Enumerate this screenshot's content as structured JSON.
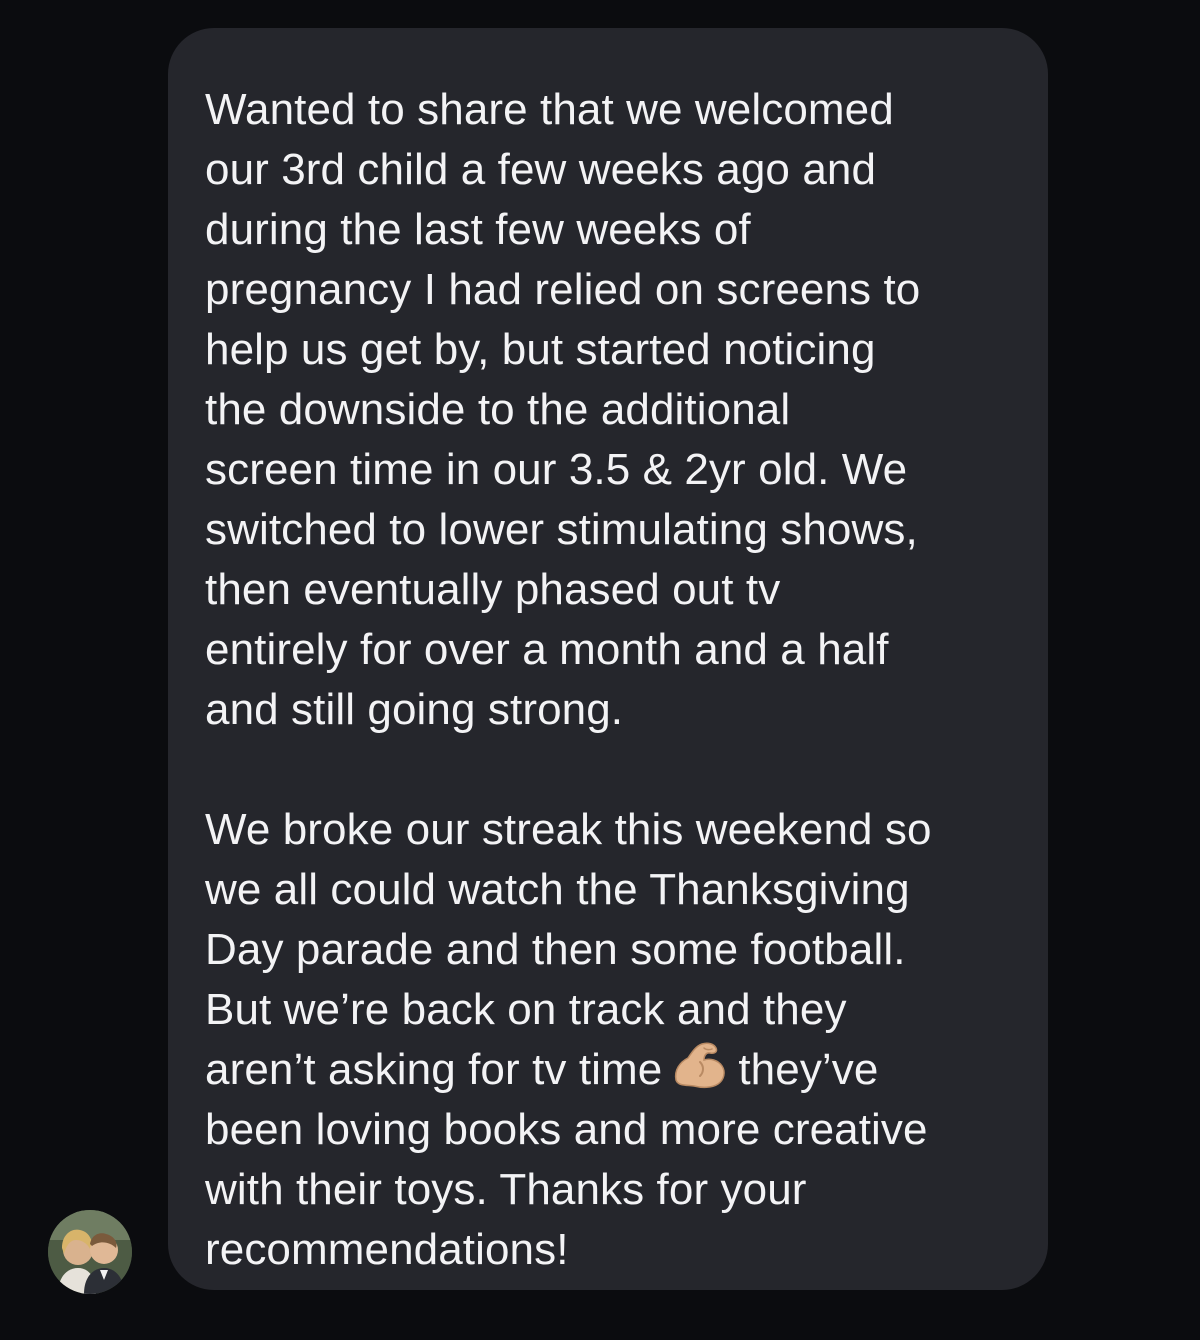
{
  "conversation": {
    "message": {
      "paragraph1": [
        "Wanted to share that we welcomed",
        "our 3rd child a few weeks ago and",
        "during the last few weeks of",
        "pregnancy I had relied on screens to",
        "help us get by, but started noticing",
        "the downside to the additional",
        "screen time in our 3.5 & 2yr old. We",
        "switched to lower stimulating shows,",
        "then eventually phased out tv",
        "entirely for over a month and a half",
        "and still going strong."
      ],
      "paragraph2": [
        "We broke our streak this weekend so",
        "we all could watch the Thanksgiving",
        "Day parade and then some football.",
        "But we’re back on track and they"
      ],
      "emoji_line": {
        "before": "aren’t asking for tv time",
        "emoji": "flexed-biceps-icon",
        "after": "they’ve"
      },
      "paragraph2_rest": [
        "been loving books and more creative",
        "with their toys. Thanks for your",
        "recommendations!"
      ]
    },
    "sender_avatar": "avatar-photo"
  },
  "colors": {
    "background": "#0b0c0f",
    "bubble": "#25262c",
    "text": "#f3f3f5"
  }
}
